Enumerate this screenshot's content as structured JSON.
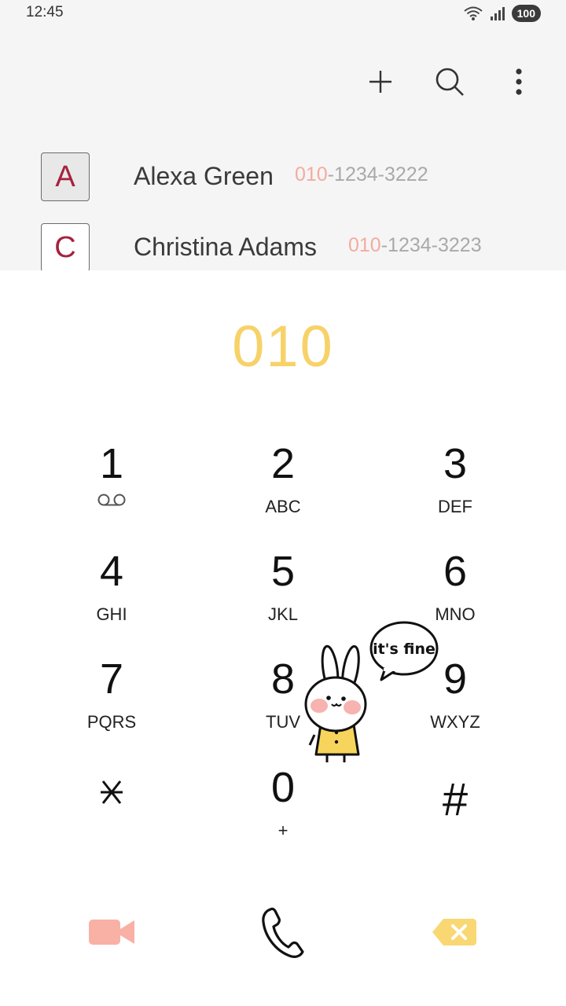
{
  "status_bar": {
    "time": "12:45",
    "battery": "100"
  },
  "toolbar": {
    "icons": [
      "add-icon",
      "search-icon",
      "more-options-icon"
    ]
  },
  "contacts": [
    {
      "initial": "A",
      "name": "Alexa Green",
      "number_match": "010",
      "number_rest": "-1234-3222"
    },
    {
      "initial": "C",
      "name": "Christina Adams",
      "number_match": "010",
      "number_rest": "-1234-3223"
    }
  ],
  "dialer": {
    "input": "010",
    "keys": [
      {
        "digit": "1",
        "letters": ""
      },
      {
        "digit": "2",
        "letters": "ABC"
      },
      {
        "digit": "3",
        "letters": "DEF"
      },
      {
        "digit": "4",
        "letters": "GHI"
      },
      {
        "digit": "5",
        "letters": "JKL"
      },
      {
        "digit": "6",
        "letters": "MNO"
      },
      {
        "digit": "7",
        "letters": "PQRS"
      },
      {
        "digit": "8",
        "letters": "TUV"
      },
      {
        "digit": "9",
        "letters": "WXYZ"
      },
      {
        "digit": "*",
        "letters": ""
      },
      {
        "digit": "0",
        "letters": "+"
      },
      {
        "digit": "#",
        "letters": ""
      }
    ]
  },
  "sticker": {
    "speech": "it's fine"
  },
  "colors": {
    "highlight": "#f4ab9f",
    "input": "#f7d268",
    "video": "#f9b1a6",
    "backspace": "#f9d873",
    "avatar_letter": "#a5223f"
  }
}
